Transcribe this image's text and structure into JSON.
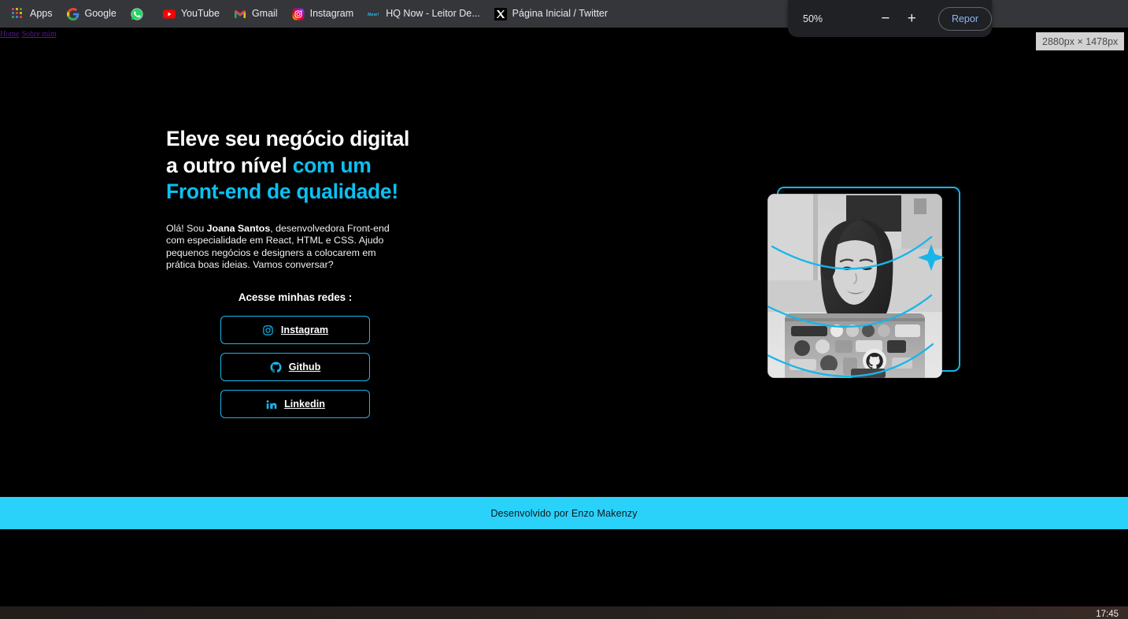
{
  "browser": {
    "bookmarks": [
      {
        "label": "Apps",
        "icon": "apps-grid-icon"
      },
      {
        "label": "Google",
        "icon": "google-icon"
      },
      {
        "label": "",
        "icon": "whatsapp-icon"
      },
      {
        "label": "YouTube",
        "icon": "youtube-icon"
      },
      {
        "label": "Gmail",
        "icon": "gmail-icon"
      },
      {
        "label": "Instagram",
        "icon": "instagram-icon"
      },
      {
        "label": "HQ Now - Leitor De...",
        "icon": "hqnow-icon"
      },
      {
        "label": "Página Inicial / Twitter",
        "icon": "twitter-x-icon"
      }
    ]
  },
  "zoom_panel": {
    "percent": "50%",
    "minus_label": "−",
    "plus_label": "+",
    "reset_label": "Repor"
  },
  "dimension_badge": {
    "text": "2880px × 1478px"
  },
  "site": {
    "nav": [
      {
        "label": "Home"
      },
      {
        "label": "Sobre mim"
      }
    ],
    "hero": {
      "headline_line1": "Eleve seu negócio digital",
      "headline_line2_plain": "a outro nível ",
      "headline_line2_accent": "com um",
      "headline_line3_accent": "Front-end de qualidade!",
      "intro_before": "Olá! Sou ",
      "intro_name": "Joana Santos",
      "intro_after": ", desenvolvedora Front-end com especialidade em React, HTML e CSS. Ajudo pequenos negócios e designers a colocarem em prática boas ideias. Vamos conversar?",
      "redes_title": "Acesse minhas redes :",
      "social_buttons": [
        {
          "label": "Instagram",
          "icon": "instagram-icon"
        },
        {
          "label": "Github",
          "icon": "github-icon"
        },
        {
          "label": "Linkedin",
          "icon": "linkedin-icon"
        }
      ],
      "portrait_alt": "Desenvolvedora sorrindo em frente a um notebook coberto de adesivos"
    },
    "footer": {
      "text": "Desenvolvido por Enzo Makenzy"
    },
    "colors": {
      "background": "#000000",
      "accent_cyan": "#0cc0f2",
      "border_cyan": "#17b6ea",
      "footer_cyan": "#2ad2fa",
      "footer_text": "#101820",
      "heading_white": "#ffffff"
    }
  },
  "taskbar": {
    "clock": "17:45"
  }
}
